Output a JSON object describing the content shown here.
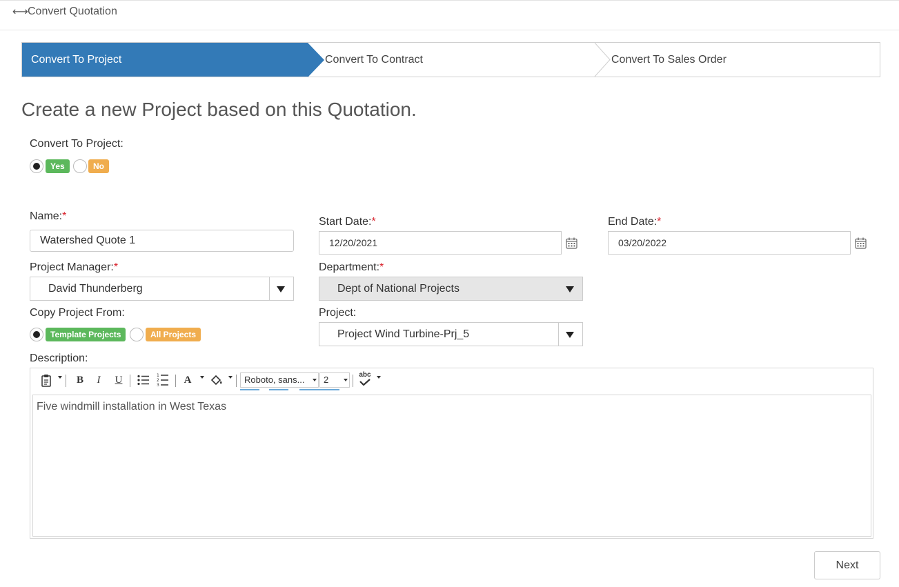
{
  "header": {
    "title": "Convert Quotation",
    "icon": "swap-horizontal-icon"
  },
  "wizard": {
    "steps": [
      {
        "label": "Convert To Project",
        "active": true
      },
      {
        "label": "Convert To Contract",
        "active": false
      },
      {
        "label": "Convert To Sales Order",
        "active": false
      }
    ]
  },
  "heading": "Create a new Project based on this Quotation.",
  "convert": {
    "label": "Convert To Project:",
    "yes": "Yes",
    "no": "No",
    "selected": "Yes"
  },
  "form": {
    "name": {
      "label": "Name:",
      "required": "*",
      "value": "Watershed Quote 1"
    },
    "start_date": {
      "label": "Start Date:",
      "required": "*",
      "value": "12/20/2021"
    },
    "end_date": {
      "label": "End Date:",
      "required": "*",
      "value": "03/20/2022"
    },
    "project_manager": {
      "label": "Project Manager:",
      "required": "*",
      "value": "David Thunderberg"
    },
    "department": {
      "label": "Department:",
      "required": "*",
      "value": "Dept of National Projects"
    },
    "copy_from": {
      "label": "Copy Project From:",
      "option_template": "Template Projects",
      "option_all": "All Projects",
      "selected": "Template Projects"
    },
    "project": {
      "label": "Project:",
      "value": "Project Wind Turbine-Prj_5"
    },
    "description": {
      "label": "Description:",
      "value": "Five windmill installation in West Texas"
    }
  },
  "editor_toolbar": {
    "bold": "B",
    "italic": "I",
    "underline": "U",
    "font_color": "A",
    "font_family": "Roboto, sans...",
    "font_size": "2",
    "spellcheck": "abc"
  },
  "colors": {
    "accent": "#337ab7",
    "green": "#5cb85c",
    "orange": "#f0ad4e",
    "required": "#d9202a"
  },
  "actions": {
    "next": "Next"
  }
}
